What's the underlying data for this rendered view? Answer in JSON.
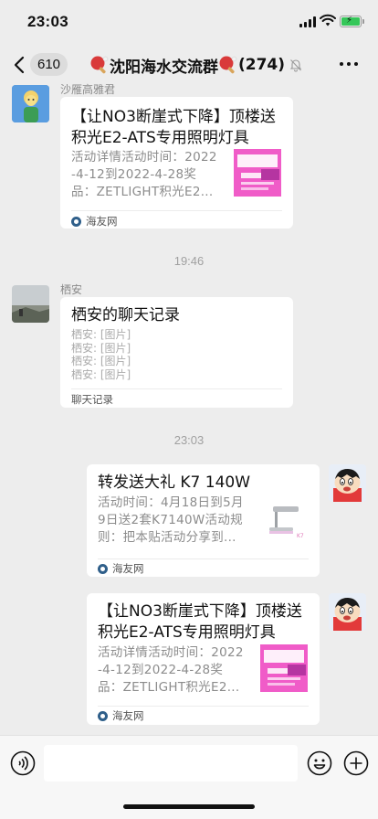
{
  "status": {
    "time": "23:03"
  },
  "nav": {
    "unread_count": "610",
    "title": "沈阳海水交流群",
    "member_count": "(274)"
  },
  "messages": [
    {
      "sender": "沙雁高雅君",
      "title_line1": "【让NO3断崖式下降】顶楼送",
      "title_line2": "积光E2-ATS专用照明灯具",
      "desc_line1": "活动详情活动时间：2022",
      "desc_line2": "-4-12到2022-4-28奖",
      "desc_line3": "品：ZETLIGHT积光E2...",
      "source": "海友网"
    },
    {
      "time": "19:46"
    },
    {
      "sender": "栖安",
      "title": "栖安的聊天记录",
      "records": [
        "栖安: [图片]",
        "栖安: [图片]",
        "栖安: [图片]",
        "栖安: [图片]"
      ],
      "footer": "聊天记录"
    },
    {
      "time": "23:03"
    },
    {
      "title": "转发送大礼 K7 140W",
      "desc_line1": "活动时间：4月18日到5月",
      "desc_line2": "9日送2套K7140W活动规",
      "desc_line3": "则：把本贴活动分享到...",
      "source": "海友网"
    },
    {
      "title_line1": "【让NO3断崖式下降】顶楼送",
      "title_line2": "积光E2-ATS专用照明灯具",
      "desc_line1": "活动详情活动时间：2022",
      "desc_line2": "-4-12到2022-4-28奖",
      "desc_line3": "品：ZETLIGHT积光E2...",
      "source": "海友网"
    }
  ],
  "icons": {
    "back": "chevron-left-icon",
    "paddle": "ping-pong-paddle-icon",
    "mute": "mute-bell-icon",
    "more": "more-dots-icon",
    "voice": "voice-icon",
    "emoji": "emoji-icon",
    "plus": "plus-icon"
  },
  "colors": {
    "background": "#ededed",
    "card": "#ffffff",
    "battery": "#35c759",
    "paddle_red": "#d93a3a"
  }
}
